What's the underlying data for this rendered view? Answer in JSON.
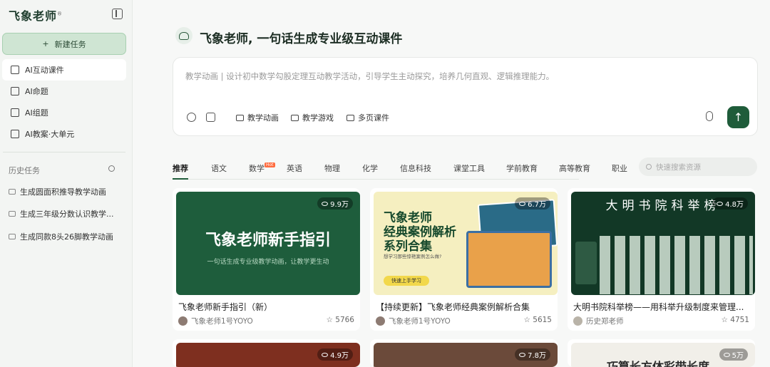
{
  "sidebar": {
    "logo": "飞象老师",
    "logo_mark": "®",
    "new_task": "新建任务",
    "nav": [
      {
        "label": "AI互动课件",
        "active": true
      },
      {
        "label": "AI命题"
      },
      {
        "label": "AI组题"
      },
      {
        "label": "AI教案·大单元"
      }
    ],
    "history_title": "历史任务",
    "history": [
      "生成圆面积推导教学动画",
      "生成三年级分数认识教学...",
      "生成同款8头26脚教学动画"
    ]
  },
  "hero": {
    "title": "飞象老师, 一句话生成专业级互动课件"
  },
  "composer": {
    "placeholder": "教学动画 | 设计初中数学勾股定理互动教学活动，引导学生主动探究，培养几何直观、逻辑推理能力。",
    "chips": [
      "教学动画",
      "教学游戏",
      "多页课件"
    ],
    "send_icon": "↑"
  },
  "tabs": [
    "推荐",
    "语文",
    "数学",
    "英语",
    "物理",
    "化学",
    "信息科技",
    "课堂工具",
    "学前教育",
    "高等教育",
    "职业"
  ],
  "tab_badge": "Hot",
  "resource_search_placeholder": "快速搜索资源",
  "cards": [
    {
      "title": "飞象老师新手指引（新）",
      "author": "飞象老师1号YOYO",
      "views": "9.9万",
      "likes": "5766",
      "thumb_title": "飞象老师新手指引",
      "thumb_sub": "一句话生成专业级教学动画，让教学更生动"
    },
    {
      "title": "【持续更新】飞象老师经典案例解析合集",
      "author": "飞象老师1号YOYO",
      "views": "6.7万",
      "likes": "5615",
      "thumb_lines": [
        "飞象老师",
        "经典案例解析",
        "系列合集"
      ],
      "thumb_sub": "想学习那些惊艳案例怎么做?",
      "thumb_btn": "快速上手学习"
    },
    {
      "title": "大明书院科举榜——用科举升级制度来管理...",
      "author": "历史郑老师",
      "views": "4.8万",
      "likes": "4751",
      "thumb_title": "大明书院科举榜"
    }
  ],
  "cards_row2": [
    {
      "views": "4.9万"
    },
    {
      "views": "7.8万"
    },
    {
      "views": "5万",
      "thumb_title": "巧算长方体彩带长度"
    }
  ]
}
